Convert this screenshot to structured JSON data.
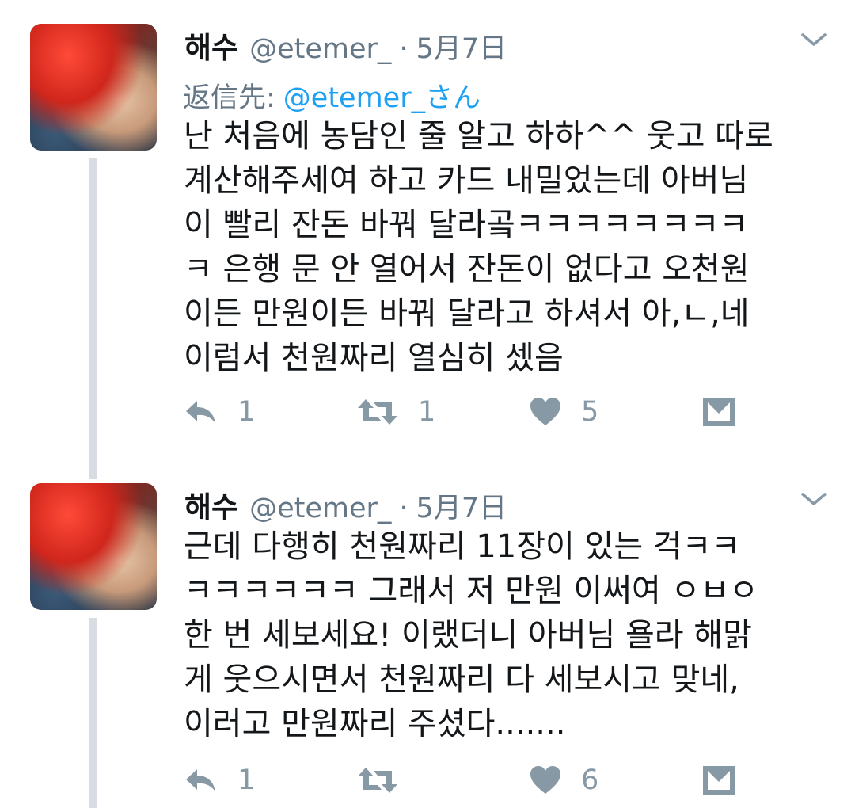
{
  "tweets": [
    {
      "author_name": "해수",
      "handle": "@etemer_",
      "separator": "·",
      "date": "5月7日",
      "reply_prefix": "返信先:",
      "reply_mention": "@etemer_さん",
      "lines": [
        "난 처음에 농담인 줄 알고 하하^^ 웃고 따로",
        "계산해주세여 하고 카드 내밀었는데 아버님",
        "이 빨리 잔돈 바꿔 달라곸ㅋㅋㅋㅋㅋㅋㅋㅋ",
        "ㅋ 은행 문 안 열어서 잔돈이 없다고 오천원",
        "이든 만원이든 바꿔 달라고 하셔서 아,ㄴ,네",
        "이럼서 천원짜리 열심히 셌음"
      ],
      "reply_count": "1",
      "retweet_count": "1",
      "like_count": "5"
    },
    {
      "author_name": "해수",
      "handle": "@etemer_",
      "separator": "·",
      "date": "5月7日",
      "lines": [
        "근데 다행히 천원짜리 11장이 있는 걱ㅋㅋ",
        "ㅋㅋㅋㅋㅋㅋ 그래서 저 만원 이써여 ㅇㅂㅇ",
        "한 번 세보세요! 이랬더니 아버님 욜라 해맑",
        "게 웃으시면서 천원짜리 다 세보시고 맞네,",
        "이러고 만원짜리 주셨다......."
      ],
      "reply_count": "1",
      "retweet_count": "",
      "like_count": "6"
    }
  ],
  "icons": {
    "reply": "reply-icon",
    "retweet": "retweet-icon",
    "like": "heart-icon",
    "message": "direct-message-icon",
    "menu": "chevron-down-icon"
  },
  "colors": {
    "text": "#14171a",
    "secondary": "#657786",
    "action": "#8899a6",
    "link": "#1da1f2",
    "thread_line": "#d7dde2"
  }
}
